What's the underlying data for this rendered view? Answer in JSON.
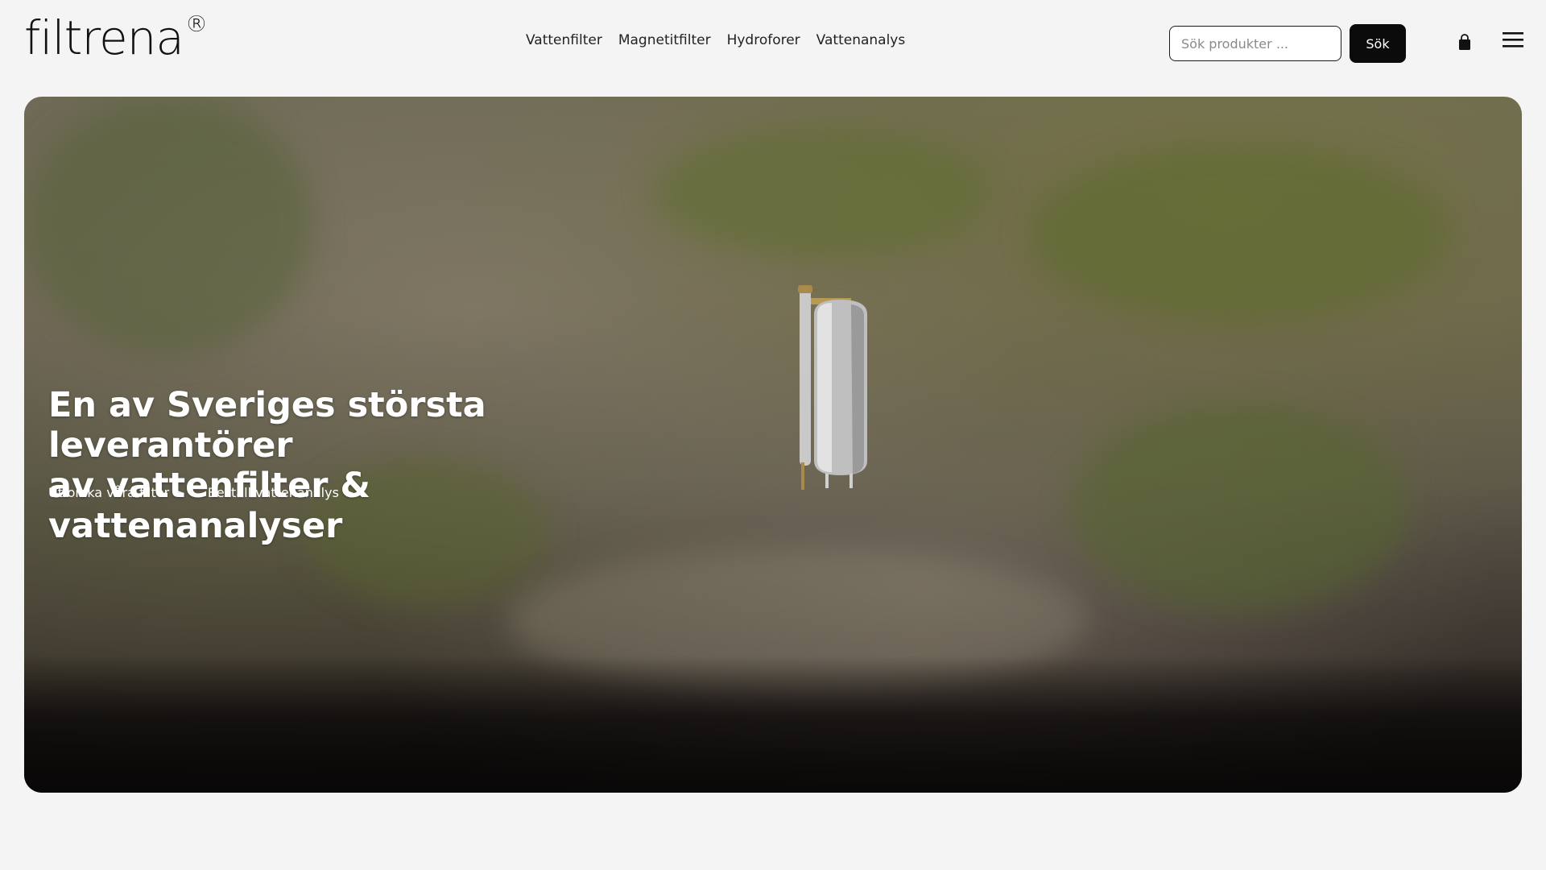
{
  "header": {
    "logo_text": "filtrena",
    "logo_mark": "®",
    "nav": [
      {
        "label": "Vattenfilter"
      },
      {
        "label": "Magnetitfilter"
      },
      {
        "label": "Hydroforer"
      },
      {
        "label": "Vattenanalys"
      }
    ],
    "search": {
      "placeholder": "Sök produkter ...",
      "value": "",
      "button_label": "Sök"
    },
    "cart_icon": "shopping-bag-icon",
    "menu_icon": "hamburger-menu-icon"
  },
  "hero": {
    "title_line1": "En av Sveriges största leverantörer",
    "title_line2": "av vattenfilter & vattenanalyser",
    "links": [
      {
        "label": "Utforska våra filter",
        "icon": "chevron-right-icon"
      },
      {
        "label": "Beställ vattenanalys",
        "icon": "chevron-right-icon"
      }
    ],
    "image_subject": "stainless steel water filter tank on rocky shoreline"
  }
}
